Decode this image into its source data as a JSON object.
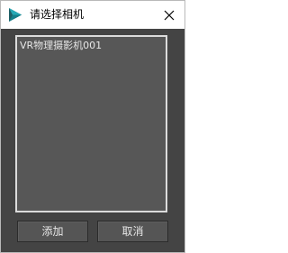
{
  "window": {
    "title": "请选择相机",
    "app_icon": "3ds-max-logo-icon",
    "close_icon": "close-icon"
  },
  "camera_list": {
    "items": [
      {
        "label": "VR物理摄影机001"
      }
    ]
  },
  "buttons": {
    "add_label": "添加",
    "cancel_label": "取消"
  },
  "colors": {
    "window_bg": "#444444",
    "list_bg": "#575757",
    "list_border": "#dcdcdc",
    "icon_teal": "#1a9aa6"
  }
}
